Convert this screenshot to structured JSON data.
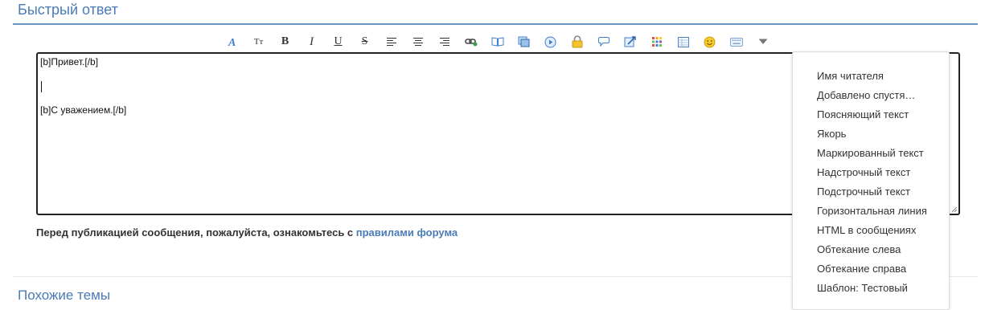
{
  "header": {
    "title": "Быстрый ответ"
  },
  "toolbar": {
    "buttons": [
      {
        "name": "font-icon"
      },
      {
        "name": "font-size-icon",
        "label": "Tт"
      },
      {
        "name": "bold-icon",
        "label": "B"
      },
      {
        "name": "italic-icon",
        "label": "I"
      },
      {
        "name": "underline-icon",
        "label": "U"
      },
      {
        "name": "strikethrough-icon",
        "label": "S"
      },
      {
        "name": "align-left-icon"
      },
      {
        "name": "align-center-icon"
      },
      {
        "name": "align-right-icon"
      },
      {
        "name": "link-icon"
      },
      {
        "name": "book-icon"
      },
      {
        "name": "image-icon"
      },
      {
        "name": "media-icon"
      },
      {
        "name": "lock-icon"
      },
      {
        "name": "quote-icon"
      },
      {
        "name": "code-icon"
      },
      {
        "name": "color-icon"
      },
      {
        "name": "table-icon"
      },
      {
        "name": "smiley-icon"
      },
      {
        "name": "keyboard-icon"
      },
      {
        "name": "more-dropdown-icon"
      }
    ]
  },
  "editor": {
    "line1": "[b]Привет.[/b]",
    "line2": "",
    "line3": "[b]С уважением.[/b]"
  },
  "notice": {
    "text": "Перед публикацией сообщения, пожалуйста, ознакомьтесь с ",
    "link": "правилами форума"
  },
  "similar": {
    "title": "Похожие темы"
  },
  "dropdown": {
    "items": [
      "Имя читателя",
      "Добавлено спустя…",
      "Поясняющий текст",
      "Якорь",
      "Маркированный текст",
      "Надстрочный текст",
      "Подстрочный текст",
      "Горизонтальная линия",
      "HTML в сообщениях",
      "Обтекание слева",
      "Обтекание справа",
      "Шаблон: Тестовый"
    ]
  },
  "colors": {
    "accent": "#4a7bb7",
    "icon_blue": "#3f7fd0",
    "lock_yellow": "#f2c230",
    "smiley_yellow": "#f5cc2a"
  }
}
